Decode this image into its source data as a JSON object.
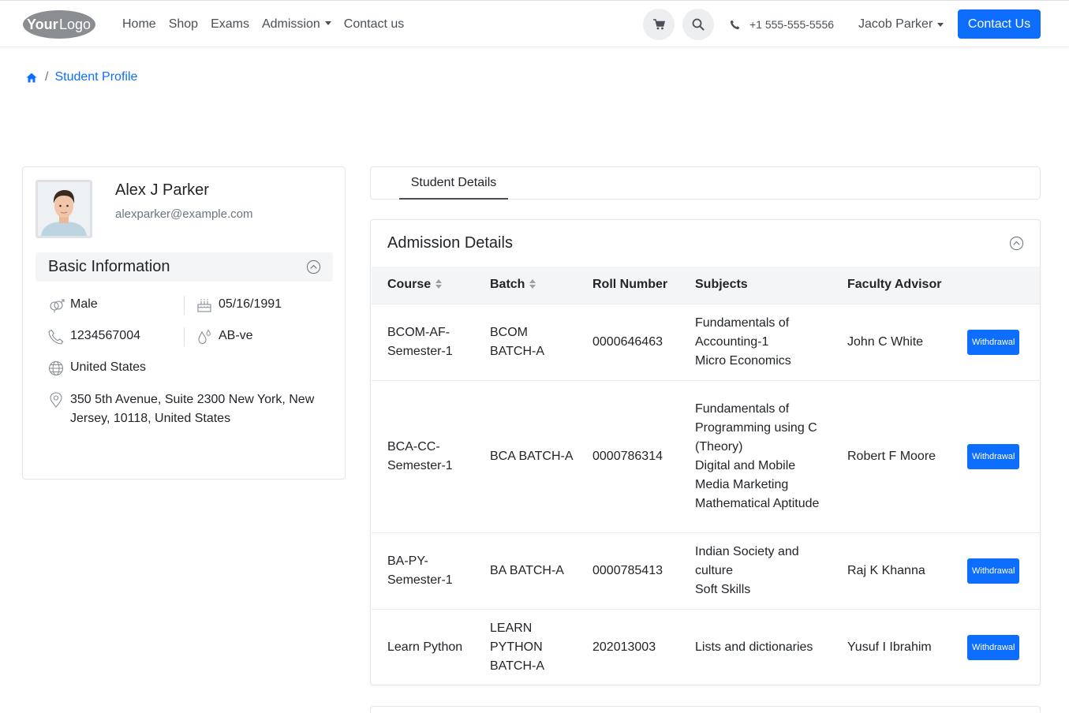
{
  "navbar": {
    "logo_text_a": "Your",
    "logo_text_b": "Logo",
    "links": [
      {
        "label": "Home"
      },
      {
        "label": "Shop"
      },
      {
        "label": "Exams"
      },
      {
        "label": "Admission"
      },
      {
        "label": "Contact us"
      }
    ],
    "phone": "+1 555-555-5556",
    "user_name": "Jacob Parker",
    "contact_button": "Contact Us"
  },
  "breadcrumb": {
    "separator": "/",
    "current": "Student Profile"
  },
  "profile": {
    "name": "Alex J Parker",
    "email": "alexparker@example.com",
    "basic_info_title": "Basic Information",
    "gender": "Male",
    "birth_date": "05/16/1991",
    "phone": "1234567004",
    "blood_group": "AB-ve",
    "country": "United States",
    "address": "350 5th Avenue, Suite 2300 New York, New Jersey, 10118, United States"
  },
  "tabs": [
    {
      "label": "Student Details",
      "active": true
    }
  ],
  "admission": {
    "title": "Admission Details",
    "columns": [
      "Course",
      "Batch",
      "Roll Number",
      "Subjects",
      "Faculty Advisor"
    ],
    "rows": [
      {
        "course": "BCOM-AF-Semester-1",
        "batch": "BCOM BATCH-A",
        "roll": "0000646463",
        "subjects": [
          "Fundamentals of Accounting-1",
          "Micro Economics"
        ],
        "advisor": "John C White",
        "action": "Withdrawal"
      },
      {
        "course": "BCA-CC-Semester-1",
        "batch": "BCA BATCH-A",
        "roll": "0000786314",
        "subjects": [
          "Fundamentals of Programming using C (Theory)",
          "Digital and Mobile Media Marketing",
          "Mathematical Aptitude"
        ],
        "advisor": "Robert F Moore",
        "action": "Withdrawal"
      },
      {
        "course": "BA-PY-Semester-1",
        "batch": "BA BATCH-A",
        "roll": "0000785413",
        "subjects": [
          "Indian Society and culture",
          "Soft Skills"
        ],
        "advisor": "Raj K Khanna",
        "action": "Withdrawal"
      },
      {
        "course": "Learn Python",
        "batch": "LEARN PYTHON BATCH-A",
        "roll": "202013003",
        "subjects": [
          "Lists and dictionaries"
        ],
        "advisor": "Yusuf I Ibrahim",
        "action": "Withdrawal"
      }
    ]
  },
  "colors": {
    "primary": "#0d6efd",
    "text": "#212529",
    "muted": "#6c757d",
    "header_bg": "#f4f5f7"
  }
}
